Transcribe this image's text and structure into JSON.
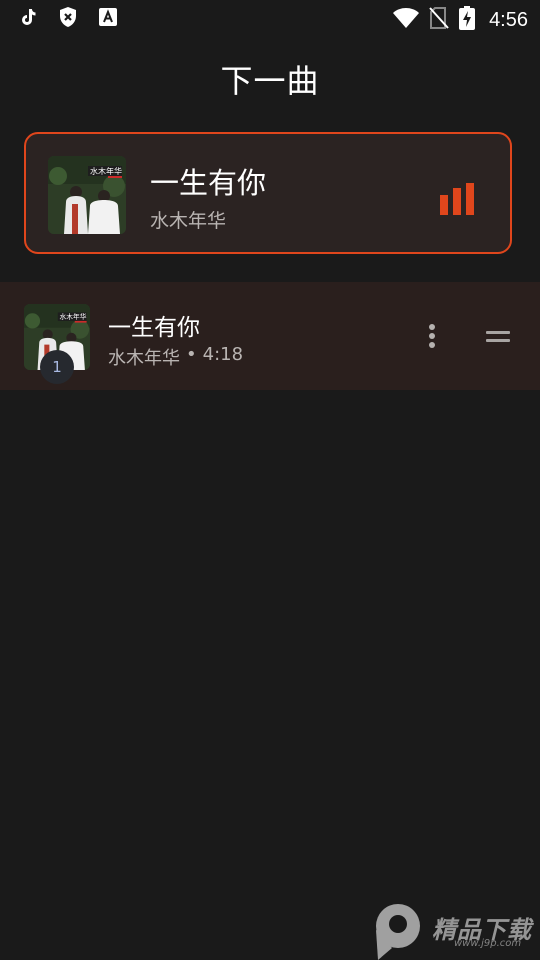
{
  "status_bar": {
    "time": "4:56",
    "left_icons": [
      "tiktok-icon",
      "shield-x-icon",
      "a-notification-icon"
    ],
    "right_icons": [
      "wifi-icon",
      "no-sim-icon",
      "battery-charging-icon"
    ]
  },
  "header": {
    "title": "下一曲"
  },
  "now_playing": {
    "title": "一生有你",
    "artist": "水木年华",
    "album_art_text": "水木年华",
    "accent_color": "#e0461c",
    "indicator_icon": "equalizer-bars-icon"
  },
  "queue": {
    "items": [
      {
        "title": "一生有你",
        "artist": "水木年华",
        "separator": "•",
        "duration": "4:18",
        "position": "1",
        "album_art_text": "水木年华"
      }
    ]
  },
  "watermark": {
    "text": "精品下载",
    "sub": "www.j9p.com"
  }
}
